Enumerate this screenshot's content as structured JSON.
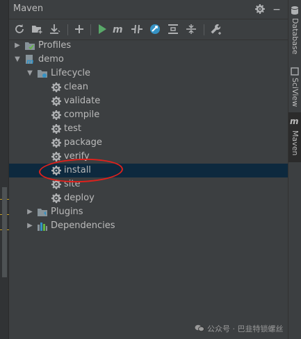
{
  "window": {
    "title": "Maven"
  },
  "titlebar_icons": [
    {
      "name": "settings-icon"
    },
    {
      "name": "minimize-icon"
    }
  ],
  "toolbar": {
    "tools": [
      {
        "name": "reload-icon"
      },
      {
        "name": "add-folder-icon"
      },
      {
        "name": "download-icon"
      },
      {
        "name": "add-icon"
      },
      {
        "name": "run-icon"
      },
      {
        "name": "execute-goal-icon"
      },
      {
        "name": "toggle-offline-icon"
      },
      {
        "name": "skip-tests-icon"
      },
      {
        "name": "show-diagram-icon"
      },
      {
        "name": "collapse-all-icon"
      },
      {
        "name": "wrench-settings-icon"
      }
    ]
  },
  "tree": {
    "profiles": {
      "label": "Profiles"
    },
    "project": {
      "label": "demo"
    },
    "lifecycle": {
      "label": "Lifecycle",
      "phases": [
        {
          "label": "clean"
        },
        {
          "label": "validate"
        },
        {
          "label": "compile"
        },
        {
          "label": "test"
        },
        {
          "label": "package"
        },
        {
          "label": "verify"
        },
        {
          "label": "install",
          "selected": true
        },
        {
          "label": "site"
        },
        {
          "label": "deploy"
        }
      ]
    },
    "plugins": {
      "label": "Plugins"
    },
    "dependencies": {
      "label": "Dependencies"
    }
  },
  "right_tabs": [
    {
      "label": "Database",
      "icon": "database-icon"
    },
    {
      "label": "SciView",
      "icon": "sciview-icon"
    },
    {
      "label": "Maven",
      "icon": "maven-icon",
      "active": true
    }
  ],
  "watermark": {
    "text": "公众号 · 巴韭特锁螺丝"
  },
  "colors": {
    "background": "#3c3f41",
    "selection": "#0d293e",
    "run_green": "#59a869",
    "accent_blue": "#3592c4",
    "annotation_red": "#e0211c"
  }
}
